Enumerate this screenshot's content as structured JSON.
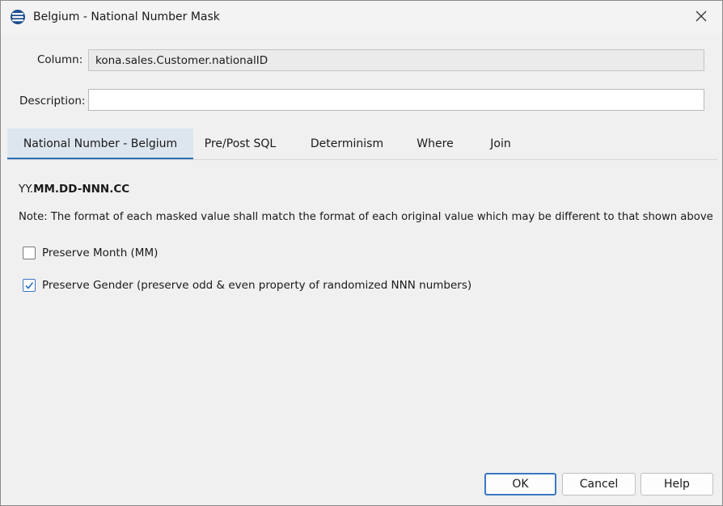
{
  "window": {
    "title": "Belgium - National Number Mask"
  },
  "form": {
    "column_label": "Column:",
    "column_value": "kona.sales.Customer.nationalID",
    "description_label": "Description:",
    "description_value": ""
  },
  "tabs": [
    {
      "label": "National Number - Belgium",
      "active": true
    },
    {
      "label": "Pre/Post SQL",
      "active": false
    },
    {
      "label": "Determinism",
      "active": false
    },
    {
      "label": "Where",
      "active": false
    },
    {
      "label": "Join",
      "active": false
    }
  ],
  "content": {
    "format_prefix": "YY.",
    "format_bold": "MM.DD-NNN.CC",
    "note": "Note: The format of each masked value shall match the format of each original value which may be different to that shown above",
    "checkboxes": [
      {
        "label": "Preserve Month (MM)",
        "checked": false
      },
      {
        "label": "Preserve Gender (preserve odd & even property of randomized NNN numbers)",
        "checked": true
      }
    ]
  },
  "buttons": {
    "ok": "OK",
    "cancel": "Cancel",
    "help": "Help"
  },
  "colors": {
    "accent": "#2f6fb8",
    "active_tab_bg": "#dde6ef",
    "window_bg": "#f0f0f0"
  }
}
